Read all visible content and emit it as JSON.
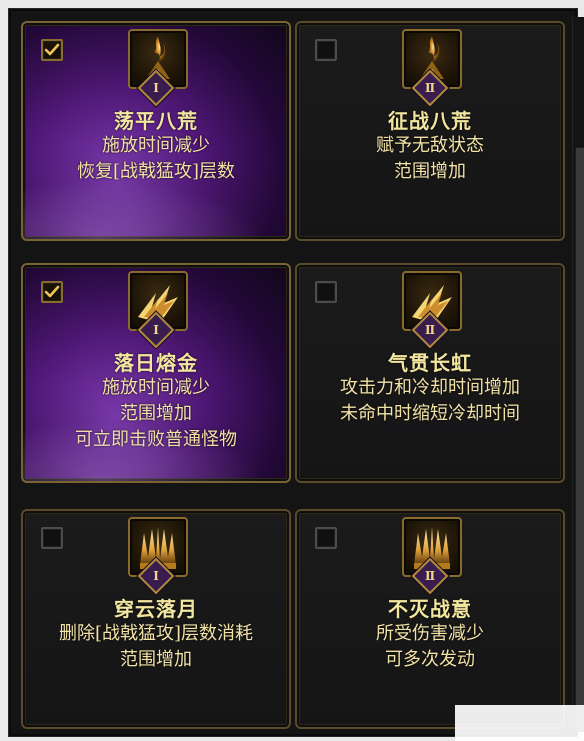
{
  "cards": [
    {
      "checked": true,
      "active": true,
      "tier": "Ⅰ",
      "icon": "flame-blade-icon",
      "title": "荡平八荒",
      "lines": [
        "施放时间减少",
        "恢复[战戟猛攻]层数"
      ]
    },
    {
      "checked": false,
      "active": false,
      "tier": "Ⅱ",
      "icon": "flame-blade-icon",
      "title": "征战八荒",
      "lines": [
        "赋予无敌状态",
        "范围增加"
      ]
    },
    {
      "checked": true,
      "active": true,
      "tier": "Ⅰ",
      "icon": "lightning-strike-icon",
      "title": "落日熔金",
      "lines": [
        "施放时间减少",
        "范围增加",
        "可立即击败普通怪物"
      ]
    },
    {
      "checked": false,
      "active": false,
      "tier": "Ⅱ",
      "icon": "lightning-strike-icon",
      "title": "气贯长虹",
      "lines": [
        "攻击力和冷却时间增加",
        "未命中时缩短冷却时间"
      ]
    },
    {
      "checked": false,
      "active": false,
      "tier": "Ⅰ",
      "icon": "blade-burst-icon",
      "title": "穿云落月",
      "lines": [
        "删除[战戟猛攻]层数消耗",
        "范围增加"
      ]
    },
    {
      "checked": false,
      "active": false,
      "tier": "Ⅱ",
      "icon": "blade-burst-icon",
      "title": "不灭战意",
      "lines": [
        "所受伤害减少",
        "可多次发动"
      ]
    }
  ],
  "colors": {
    "gold": "#f3e7a0",
    "border": "#5a4a2a",
    "active_purple": "#6b1e9e"
  }
}
